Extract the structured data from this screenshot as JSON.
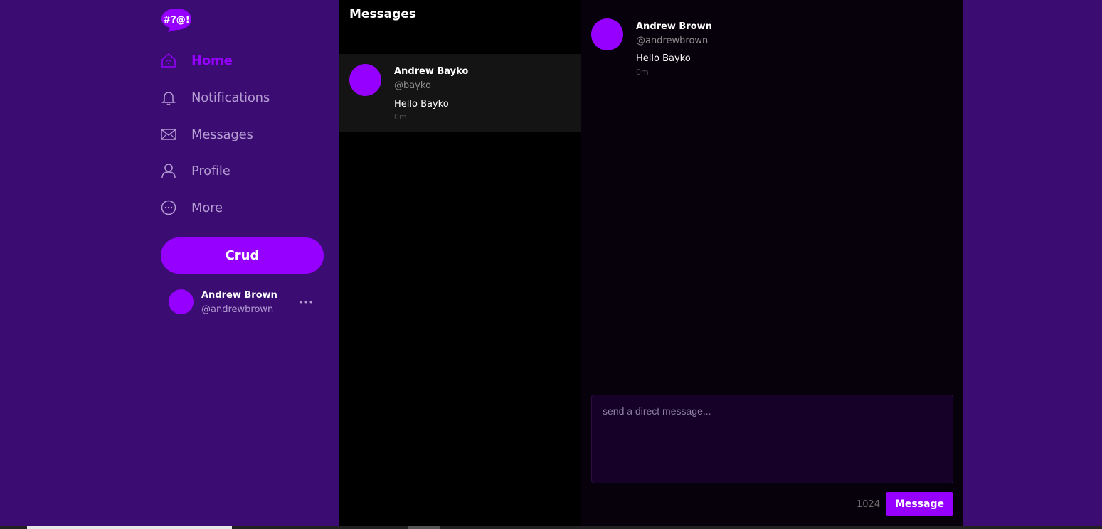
{
  "app": {
    "logo_text": "#?@!",
    "brand_color": "#9500ff",
    "sidebar_bg": "#3b0d72"
  },
  "nav": {
    "items": [
      {
        "label": "Home",
        "icon": "home-icon",
        "active": true
      },
      {
        "label": "Notifications",
        "icon": "bell-icon",
        "active": false
      },
      {
        "label": "Messages",
        "icon": "envelope-icon",
        "active": false
      },
      {
        "label": "Profile",
        "icon": "person-icon",
        "active": false
      },
      {
        "label": "More",
        "icon": "more-circle-icon",
        "active": false
      }
    ]
  },
  "crud_button": {
    "label": "Crud"
  },
  "current_user": {
    "name": "Andrew Brown",
    "handle": "@andrewbrown"
  },
  "messages_panel": {
    "title": "Messages",
    "conversations": [
      {
        "name": "Andrew Bayko",
        "handle": "@bayko",
        "last_message": "Hello Bayko",
        "time": "0m"
      }
    ]
  },
  "conversation": {
    "messages": [
      {
        "name": "Andrew Brown",
        "handle": "@andrewbrown",
        "text": "Hello Bayko",
        "time": "0m"
      }
    ],
    "input": {
      "placeholder": "send a direct message...",
      "value": ""
    },
    "char_count": "1024",
    "send_label": "Message"
  }
}
